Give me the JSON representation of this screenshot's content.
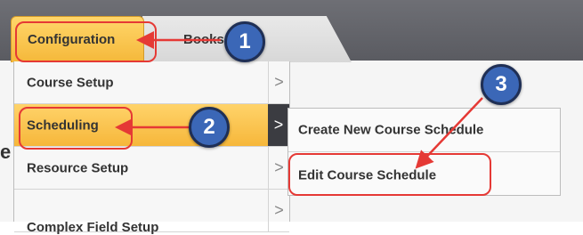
{
  "tabs": [
    {
      "label": "Configuration"
    },
    {
      "label": "Books"
    }
  ],
  "menu": {
    "items": [
      {
        "label": "Course Setup"
      },
      {
        "label": "Scheduling"
      },
      {
        "label": "Resource Setup"
      },
      {
        "label": "Complex Field Setup"
      }
    ],
    "chevron": ">"
  },
  "submenu": {
    "items": [
      {
        "label": "Create New Course Schedule"
      },
      {
        "label": "Edit Course Schedule"
      }
    ]
  },
  "callouts": [
    "1",
    "2",
    "3"
  ],
  "side_letter": "e",
  "colors": {
    "topbar": "#5f6066",
    "active_gold": "#f6b73a",
    "callout_blue": "#3b67b7",
    "annotation_red": "#e53935"
  }
}
